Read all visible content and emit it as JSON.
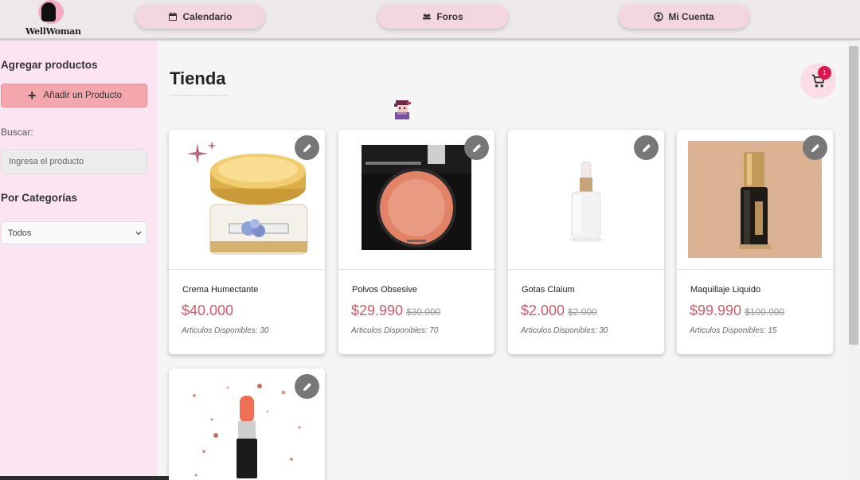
{
  "app": {
    "logo_text": "WellWoman"
  },
  "nav": {
    "items": [
      {
        "label": "Calendario",
        "icon": "calendar-icon"
      },
      {
        "label": "Foros",
        "icon": "people-icon"
      },
      {
        "label": "Mi Cuenta",
        "icon": "account-circle-icon"
      }
    ]
  },
  "sidebar": {
    "add_heading": "Agregar productos",
    "add_button": "Añadir un Producto",
    "search_label": "Buscar:",
    "search_placeholder": "Ingresa el producto",
    "category_heading": "Por Categorías",
    "category_selected": "Todos"
  },
  "main": {
    "title": "Tienda",
    "cart_count": "1"
  },
  "products": [
    {
      "name": "Crema Humectante",
      "price": "$40.000",
      "old_price": "",
      "stock": "Articulos Disponibles: 30"
    },
    {
      "name": "Polvos Obsesive",
      "price": "$29.990",
      "old_price": "$30.000",
      "stock": "Articulos Disponibles: 70"
    },
    {
      "name": "Gotas Claium",
      "price": "$2.000",
      "old_price": "$2.000",
      "stock": "Articulos Disponibles: 30"
    },
    {
      "name": "Maquillaje Liquido",
      "price": "$99.990",
      "old_price": "$100.000",
      "stock": "Articulos Disponibles: 15"
    },
    {
      "name": "",
      "price": "",
      "old_price": "",
      "stock": ""
    }
  ],
  "colors": {
    "accent_pink": "#f4a6ad",
    "sidebar_bg": "#fde4f2",
    "price": "#c85c6c",
    "badge": "#e0174f"
  }
}
